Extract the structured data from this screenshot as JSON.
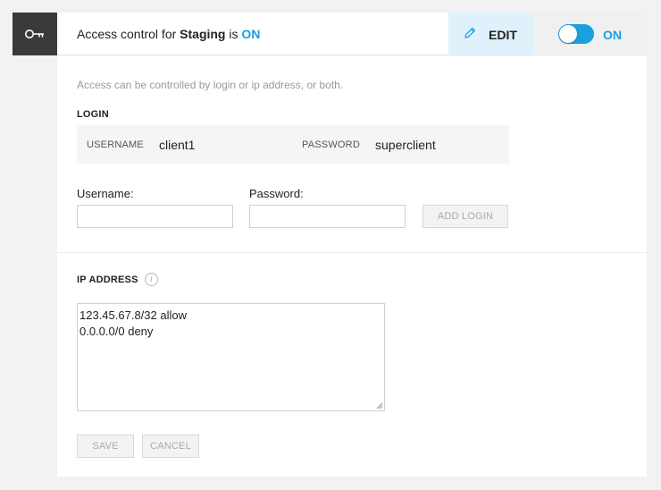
{
  "header": {
    "key_icon": "key-icon",
    "title_prefix": "Access control for ",
    "environment": "Staging",
    "title_middle": " is ",
    "status": "ON",
    "edit_label": "EDIT",
    "edit_icon": "pencil-icon",
    "toggle_label": "ON",
    "toggle_state": "on",
    "accent_color": "#1aa0dc"
  },
  "description": "Access can be controlled by login or ip address, or both.",
  "login": {
    "section_title": "LOGIN",
    "username_label": "USERNAME",
    "username_value": "client1",
    "password_label": "PASSWORD",
    "password_value": "superclient",
    "form": {
      "username_field_label": "Username:",
      "username_value": "",
      "password_field_label": "Password:",
      "password_value": "",
      "add_button_label": "ADD LOGIN"
    }
  },
  "ip": {
    "section_title": "IP ADDRESS",
    "info_icon": "info-icon",
    "lines": [
      "123.45.67.8/32 allow",
      "0.0.0.0/0 deny"
    ]
  },
  "actions": {
    "save_label": "SAVE",
    "cancel_label": "CANCEL"
  }
}
